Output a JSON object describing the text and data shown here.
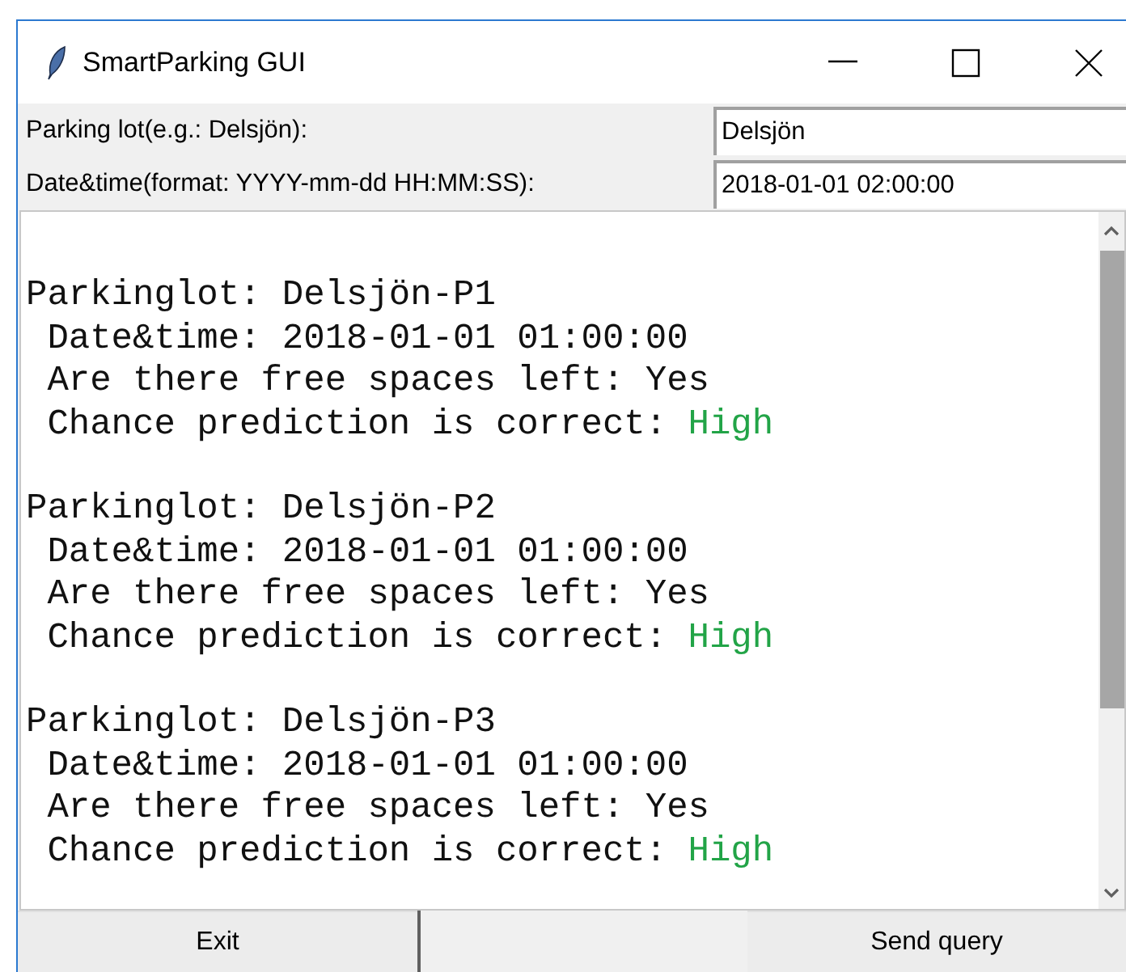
{
  "window": {
    "title": "SmartParking GUI"
  },
  "fields": [
    {
      "label": "Parking lot(e.g.: Delsjön):",
      "value": "Delsjön"
    },
    {
      "label": "Date&time(format: YYYY-mm-dd HH:MM:SS):",
      "value": "2018-01-01 02:00:00"
    }
  ],
  "output": [
    {
      "lines": [
        {
          "text": "Parkinglot: Delsjön-P1"
        },
        {
          "text": " Date&time: 2018-01-01 01:00:00"
        },
        {
          "text": " Are there free spaces left: Yes"
        },
        {
          "text": " Chance prediction is correct: ",
          "value": "High",
          "color": "#22a447"
        }
      ]
    },
    {
      "lines": [
        {
          "text": "Parkinglot: Delsjön-P2"
        },
        {
          "text": " Date&time: 2018-01-01 01:00:00"
        },
        {
          "text": " Are there free spaces left: Yes"
        },
        {
          "text": " Chance prediction is correct: ",
          "value": "High",
          "color": "#22a447"
        }
      ]
    },
    {
      "lines": [
        {
          "text": "Parkinglot: Delsjön-P3"
        },
        {
          "text": " Date&time: 2018-01-01 01:00:00"
        },
        {
          "text": " Are there free spaces left: Yes"
        },
        {
          "text": " Chance prediction is correct: ",
          "value": "High",
          "color": "#22a447"
        }
      ]
    }
  ],
  "buttons": [
    "Exit",
    "Send query"
  ]
}
